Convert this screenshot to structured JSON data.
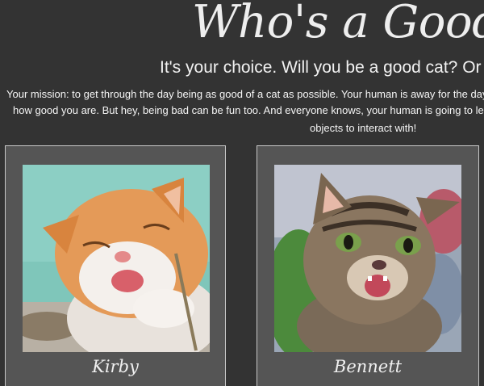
{
  "header": {
    "title": "Who's a Good Cat?",
    "subtitle": "It's your choice. Will you be a good cat? Or a bad cat?",
    "mission_line1": "Your mission: to get through the day being as good of a cat as possible. Your human is away for the day and will be able to tell",
    "mission_line2": "how good you are. But hey, being bad can be fun too. And everyone knows, your human is going to leave plenty of tempting",
    "mission_line3": "objects to interact with!"
  },
  "cats": [
    {
      "name": "Kirby"
    },
    {
      "name": "Bennett"
    }
  ],
  "colors": {
    "background": "#333333",
    "card": "#555555",
    "text": "#f2f2f2"
  }
}
